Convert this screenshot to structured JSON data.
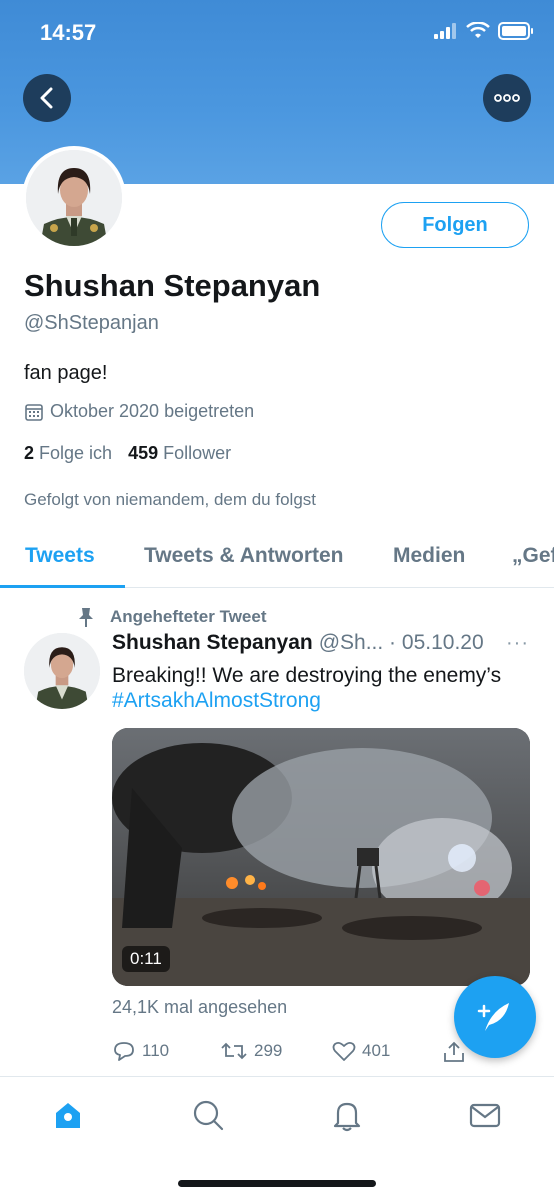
{
  "status_bar": {
    "time": "14:57"
  },
  "colors": {
    "accent": "#1da1f2",
    "banner": "#4b97df",
    "muted": "#657786",
    "text": "#14171a"
  },
  "header": {
    "back_icon": "chevron-left-icon",
    "more_icon": "more-horizontal-icon"
  },
  "profile": {
    "follow_label": "Folgen",
    "name": "Shushan Stepanyan",
    "handle": "@ShStepanjan",
    "bio": "fan page!",
    "joined": "Oktober 2020 beigetreten",
    "following_count": "2",
    "following_label": "Folge ich",
    "followers_count": "459",
    "followers_label": "Follower",
    "followed_by": "Gefolgt von niemandem, dem du folgst"
  },
  "tabs": [
    {
      "label": "Tweets",
      "active": true
    },
    {
      "label": "Tweets & Antworten",
      "active": false
    },
    {
      "label": "Medien",
      "active": false
    },
    {
      "label": "„Gef",
      "active": false
    }
  ],
  "tweet": {
    "pinned_label": "Angehefteter Tweet",
    "author": "Shushan Stepanyan",
    "meta": "@Sh... · 05.10.20",
    "more": "···",
    "text": "Breaking!! We are destroying the enemy’s",
    "hashtag": "#ArtsakhAlmostStrong",
    "video_duration": "0:11",
    "views": "24,1K mal angesehen",
    "replies": "110",
    "retweets": "299",
    "likes": "401"
  },
  "nav": [
    "home-icon",
    "search-icon",
    "notifications-icon",
    "messages-icon"
  ]
}
